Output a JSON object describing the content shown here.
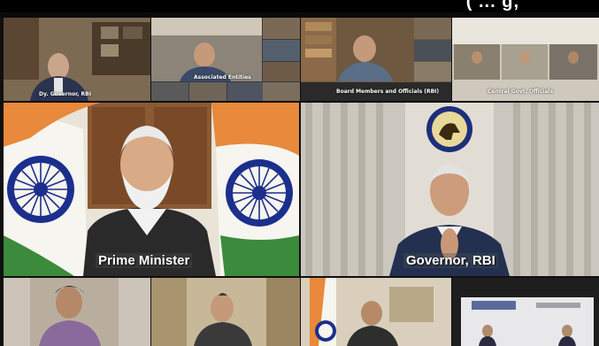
{
  "banner": {
    "text": "( ... g,"
  },
  "top_row": [
    {
      "caption": "Dy. Governor, RBI"
    },
    {
      "caption": "Associated Entities"
    },
    {
      "caption": "Board Members and Officials (RBI)"
    },
    {
      "caption": "Central Govt. Officials"
    }
  ],
  "main": {
    "left_caption": "Prime Minister",
    "right_caption": "Governor, RBI"
  },
  "colors": {
    "saffron": "#e8893b",
    "green": "#3c8a3c",
    "chakra_blue": "#1c2f8c",
    "caption_white": "#ffffff"
  },
  "icons": [
    "ashoka-chakra-icon",
    "rbi-emblem-icon",
    "indian-flag-icon"
  ]
}
